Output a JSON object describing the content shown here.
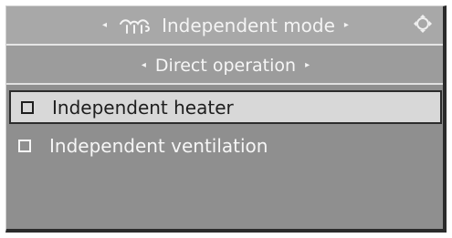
{
  "header": {
    "title": "Independent mode",
    "left_arrow_icon": "left-arrow-icon",
    "right_arrow_icon": "right-arrow-icon",
    "mode_icon": "heater-icon",
    "corner_icon": "navigation-dial-icon"
  },
  "subheader": {
    "title": "Direct operation",
    "left_arrow_icon": "left-arrow-icon",
    "right_arrow_icon": "right-arrow-icon"
  },
  "menu": {
    "items": [
      {
        "label": "Independent heater",
        "selected": true,
        "checked": false
      },
      {
        "label": "Independent ventilation",
        "selected": false,
        "checked": false
      }
    ]
  },
  "colors": {
    "panel_background": "#8f8f8f",
    "header_background": "#a8a8a8",
    "selection_background": "#d8d8d8",
    "text_light": "#f6f6f6",
    "text_dark": "#1e1e1e",
    "border_dark": "#2c2c2c"
  }
}
